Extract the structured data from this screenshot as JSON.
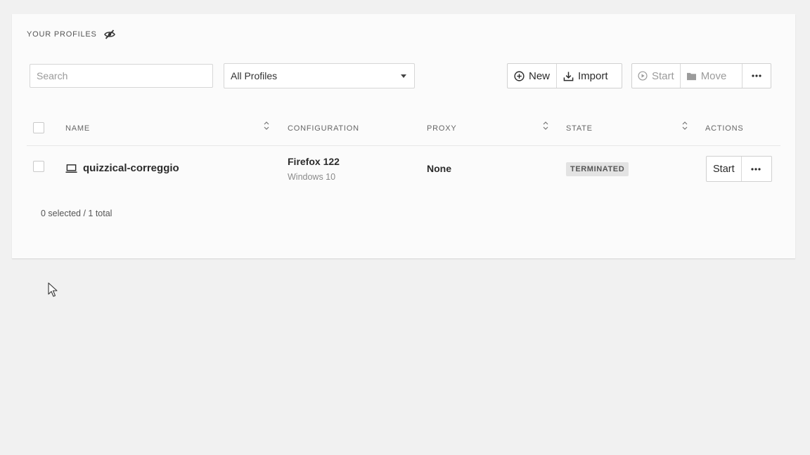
{
  "header": {
    "title": "YOUR PROFILES",
    "visibility_icon": "eye-off-icon"
  },
  "filters": {
    "search_placeholder": "Search",
    "profile_filter_value": "All Profiles"
  },
  "toolbar": {
    "new_label": "New",
    "import_label": "Import",
    "start_label": "Start",
    "move_label": "Move"
  },
  "table": {
    "columns": {
      "name": "NAME",
      "configuration": "CONFIGURATION",
      "proxy": "PROXY",
      "state": "STATE",
      "actions": "ACTIONS"
    },
    "rows": [
      {
        "name": "quizzical-correggio",
        "config_browser": "Firefox 122",
        "config_os": "Windows 10",
        "proxy": "None",
        "state": "TERMINATED",
        "action_label": "Start"
      }
    ]
  },
  "footer": {
    "summary": "0 selected / 1 total"
  },
  "colors": {
    "badge_bg": "#e3e3e3",
    "border": "#d0d0d0",
    "disabled_text": "#9b9b9b"
  }
}
